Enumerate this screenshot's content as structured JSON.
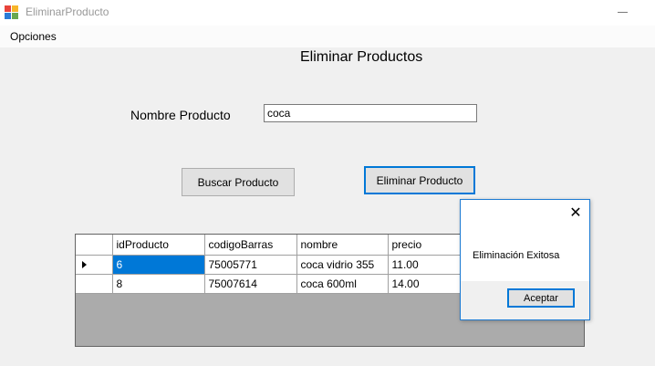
{
  "window": {
    "title": "EliminarProducto",
    "icon": "winforms-app-icon",
    "minimize_icon": "minimize-icon"
  },
  "menu": {
    "items": [
      {
        "label": "Opciones"
      }
    ]
  },
  "form": {
    "title": "Eliminar Productos",
    "product_name_label": "Nombre Producto",
    "product_name_value": "coca",
    "search_button": "Buscar Producto",
    "delete_button": "Eliminar Producto"
  },
  "grid": {
    "columns": [
      "idProducto",
      "codigoBarras",
      "nombre",
      "precio"
    ],
    "rows": [
      [
        "6",
        "75005771",
        "coca vidrio 355",
        "11.00"
      ],
      [
        "8",
        "75007614",
        "coca 600ml",
        "14.00"
      ]
    ],
    "current_row_icon": "row-pointer-icon"
  },
  "message_box": {
    "text": "Eliminación Exitosa",
    "ok_button": "Aceptar",
    "close_icon": "close-icon"
  },
  "colors": {
    "accent": "#0078d7",
    "grid_background": "#ababab",
    "window_background": "#f0f0f0"
  }
}
